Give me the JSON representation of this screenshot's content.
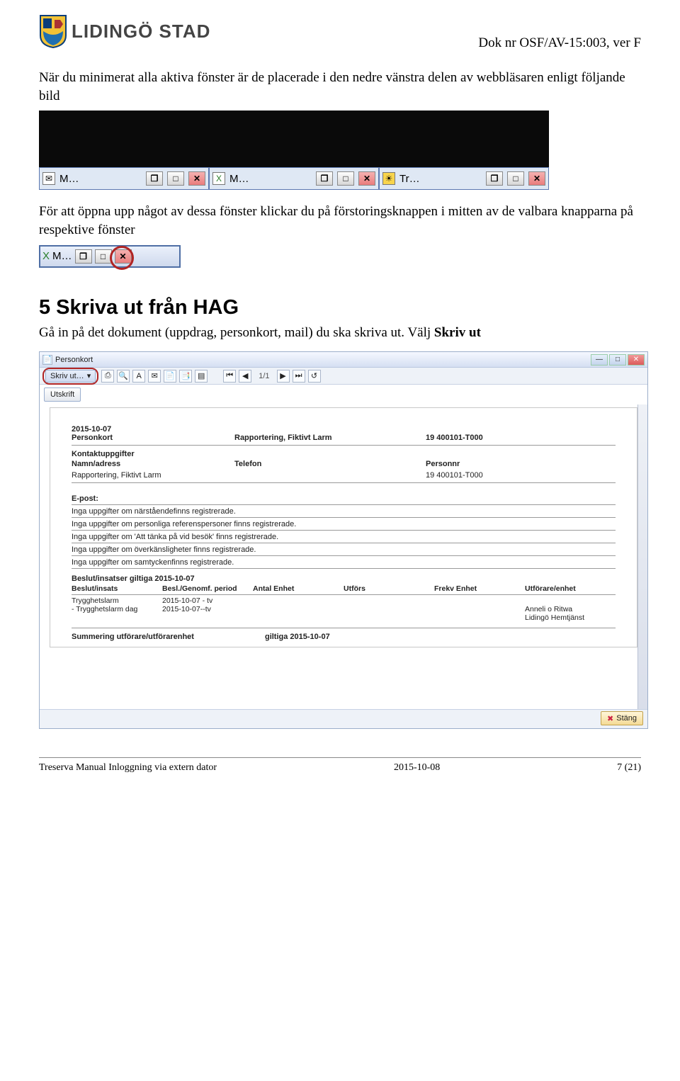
{
  "header": {
    "brand": "LIDINGÖ STAD",
    "docnum": "Dok nr OSF/AV-15:003, ver F"
  },
  "para1": "När du minimerat alla aktiva fönster är de placerade i den nedre vänstra delen av webbläsaren enligt följande bild",
  "taskbar": {
    "items": [
      {
        "label": "M…"
      },
      {
        "label": "M…"
      },
      {
        "label": "Tr…"
      }
    ]
  },
  "para2": "För att öppna upp något av dessa fönster klickar du på förstoringsknappen i mitten av de valbara knapparna på respektive fönster",
  "smalltask": {
    "label": "M…"
  },
  "h2": "5  Skriva ut från HAG",
  "para3": "Gå in på det dokument (uppdrag, personkort, mail) du ska skriva ut. Välj ",
  "para3b": "Skriv ut",
  "window": {
    "title": "Personkort",
    "skrivut": "Skriv ut…",
    "pagenum": "1/1",
    "utskrift": "Utskrift",
    "stang": "Stäng",
    "doc": {
      "date": "2015-10-07",
      "head": {
        "c1": "Personkort",
        "c2": "Rapportering, Fiktivt Larm",
        "c3": "19 400101-T000"
      },
      "kontakt_head": "Kontaktuppgifter",
      "kontakt_labels": {
        "c1": "Namn/adress",
        "c2": "Telefon",
        "c3": "Personnr"
      },
      "kontakt_vals": {
        "c1": "Rapportering, Fiktivt Larm",
        "c3": "19 400101-T000"
      },
      "epost": "E-post:",
      "msgs": [
        "Inga uppgifter om närståendefinns registrerade.",
        "Inga uppgifter om personliga referenspersoner finns registrerade.",
        "Inga uppgifter om 'Att tänka på vid besök' finns registrerade.",
        "Inga uppgifter om överkänsligheter finns registrerade.",
        "Inga uppgifter om samtyckenfinns registrerade."
      ],
      "beslut_head": "Beslut/insatser giltiga     2015-10-07",
      "beslut_cols": {
        "a": "Beslut/insats",
        "b": "Besl./Genomf. period",
        "c": "Antal Enhet",
        "d": "Utförs",
        "e": "Frekv Enhet",
        "f": "Utförare/enhet"
      },
      "beslut_r1": {
        "a": "Trygghetslarm",
        "b": "2015-10-07 - tv"
      },
      "beslut_r2": {
        "a": "-  Trygghetslarm dag",
        "b": "2015-10-07--tv",
        "f1": "Anneli o Ritwa",
        "f2": "Lidingö Hemtjänst"
      },
      "sum": "Summering utförare/utförarenhet",
      "sum2": "giltiga   2015-10-07"
    }
  },
  "footer": {
    "left": "Treserva Manual Inloggning via extern dator",
    "mid": "2015-10-08",
    "right": "7 (21)"
  }
}
